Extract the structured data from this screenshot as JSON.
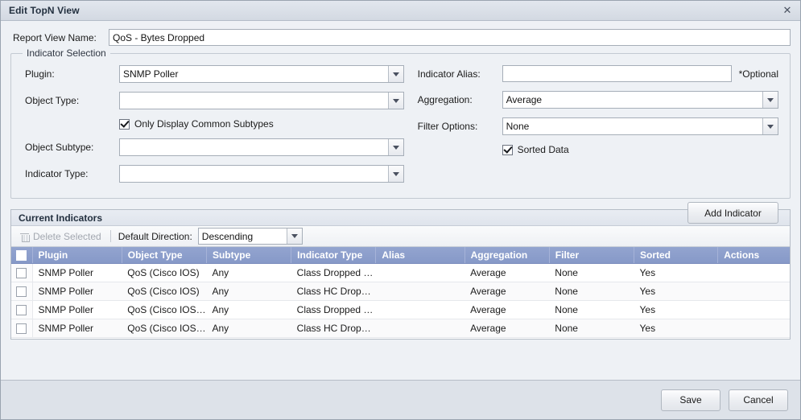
{
  "window": {
    "title": "Edit TopN View",
    "close_icon": "close-icon"
  },
  "form": {
    "report_view_name_label": "Report View Name:",
    "report_view_name_value": "QoS - Bytes Dropped",
    "report_view_name_placeholder": ""
  },
  "indicator_selection": {
    "legend": "Indicator Selection",
    "left": {
      "plugin_label": "Plugin:",
      "plugin_value": "SNMP Poller",
      "object_type_label": "Object Type:",
      "object_type_value": "",
      "only_common_subtypes_label": "Only Display Common Subtypes",
      "only_common_subtypes_checked": true,
      "object_subtype_label": "Object Subtype:",
      "object_subtype_value": "",
      "indicator_type_label": "Indicator Type:",
      "indicator_type_value": ""
    },
    "right": {
      "indicator_alias_label": "Indicator Alias:",
      "indicator_alias_value": "",
      "indicator_alias_optional_note": "*Optional",
      "aggregation_label": "Aggregation:",
      "aggregation_value": "Average",
      "filter_options_label": "Filter Options:",
      "filter_options_value": "None",
      "sorted_data_label": "Sorted Data",
      "sorted_data_checked": true
    },
    "add_indicator_label": "Add Indicator"
  },
  "current_indicators": {
    "panel_title": "Current Indicators",
    "toolbar": {
      "delete_selected_label": "Delete Selected",
      "delete_selected_enabled": false,
      "delete_icon": "trash-icon",
      "default_direction_label": "Default Direction:",
      "default_direction_value": "Descending"
    },
    "columns": [
      "Plugin",
      "Object Type",
      "Subtype",
      "Indicator Type",
      "Alias",
      "Aggregation",
      "Filter",
      "Sorted",
      "Actions"
    ],
    "rows": [
      {
        "plugin": "SNMP Poller",
        "object_type": "QoS (Cisco IOS)",
        "subtype": "Any",
        "indicator_type": "Class Dropped byt...",
        "alias": "",
        "aggregation": "Average",
        "filter": "None",
        "sorted": "Yes",
        "actions": ""
      },
      {
        "plugin": "SNMP Poller",
        "object_type": "QoS (Cisco IOS)",
        "subtype": "Any",
        "indicator_type": "Class HC Dropped...",
        "alias": "",
        "aggregation": "Average",
        "filter": "None",
        "sorted": "Yes",
        "actions": ""
      },
      {
        "plugin": "SNMP Poller",
        "object_type": "QoS (Cisco IOS XR)",
        "subtype": "Any",
        "indicator_type": "Class Dropped byt...",
        "alias": "",
        "aggregation": "Average",
        "filter": "None",
        "sorted": "Yes",
        "actions": ""
      },
      {
        "plugin": "SNMP Poller",
        "object_type": "QoS (Cisco IOS XR)",
        "subtype": "Any",
        "indicator_type": "Class HC Dropped...",
        "alias": "",
        "aggregation": "Average",
        "filter": "None",
        "sorted": "Yes",
        "actions": ""
      }
    ]
  },
  "footer": {
    "save_label": "Save",
    "cancel_label": "Cancel"
  },
  "colors": {
    "grid_header": "#8a9cca",
    "titlebar": "#d8dee6",
    "dialog_bg": "#eef1f5",
    "footer_bg": "#dde2e9",
    "disabled_text": "#a3a8b0"
  }
}
